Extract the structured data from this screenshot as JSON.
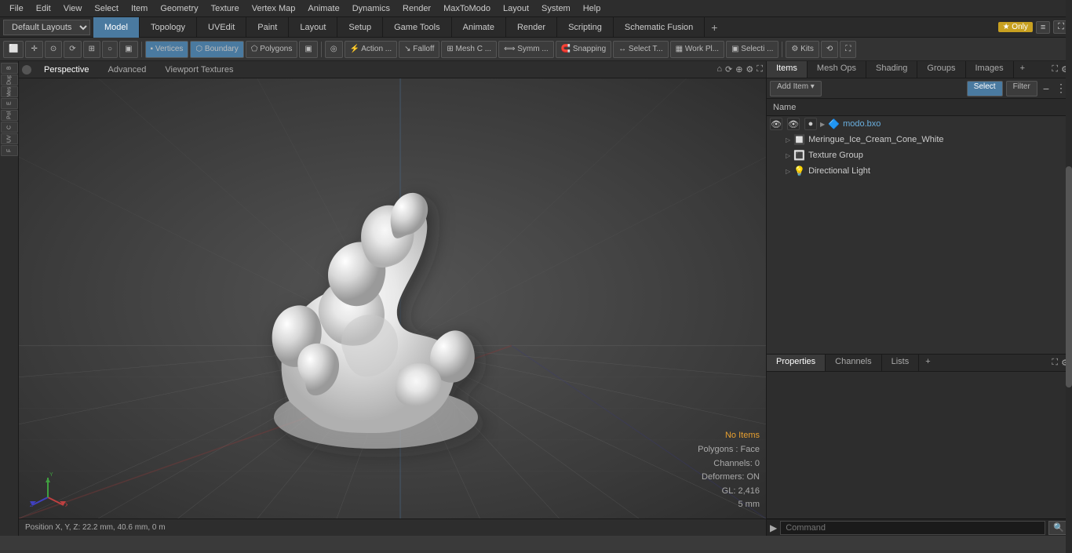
{
  "menubar": {
    "items": [
      "File",
      "Edit",
      "View",
      "Select",
      "Item",
      "Geometry",
      "Texture",
      "Vertex Map",
      "Animate",
      "Dynamics",
      "Render",
      "MaxToModo",
      "Layout",
      "System",
      "Help"
    ]
  },
  "layout": {
    "dropdown": "Default Layouts",
    "tabs": [
      "Model",
      "Topology",
      "UVEdit",
      "Paint",
      "Layout",
      "Setup",
      "Game Tools",
      "Animate",
      "Render",
      "Scripting",
      "Schematic Fusion"
    ],
    "active_tab": "Model",
    "plus_label": "+",
    "star_label": "★ Only"
  },
  "toolbar": {
    "buttons": [
      {
        "label": "⬛",
        "name": "select-mode-box"
      },
      {
        "label": "⊕",
        "name": "transform-btn"
      },
      {
        "label": "⟳",
        "name": "rotate-btn"
      },
      {
        "label": "Vertices",
        "name": "vertices-btn"
      },
      {
        "label": "Boundary",
        "name": "boundary-btn"
      },
      {
        "label": "Polygons",
        "name": "polygons-btn"
      },
      {
        "label": "▣",
        "name": "poly-type-btn"
      },
      {
        "label": "○",
        "name": "circle-btn"
      },
      {
        "label": "Action ...",
        "name": "action-btn"
      },
      {
        "label": "Falloff",
        "name": "falloff-btn"
      },
      {
        "label": "Mesh C ...",
        "name": "mesh-constraint-btn"
      },
      {
        "label": "Symm ...",
        "name": "symmetry-btn"
      },
      {
        "label": "Snapping",
        "name": "snapping-btn"
      },
      {
        "label": "Select T...",
        "name": "select-transform-btn"
      },
      {
        "label": "Work Pl...",
        "name": "work-plane-btn"
      },
      {
        "label": "Selecti ...",
        "name": "selection-btn"
      },
      {
        "label": "Kits",
        "name": "kits-btn"
      },
      {
        "label": "⟲",
        "name": "undo-view-btn"
      },
      {
        "label": "⛶",
        "name": "fullscreen-btn"
      }
    ]
  },
  "viewport": {
    "tabs": [
      "Perspective",
      "Advanced",
      "Viewport Textures"
    ],
    "active_tab": "Perspective"
  },
  "viewport_status": {
    "no_items": "No Items",
    "polygons": "Polygons : Face",
    "channels": "Channels: 0",
    "deformers": "Deformers: ON",
    "gl": "GL: 2,416",
    "size": "5 mm"
  },
  "status_bar": {
    "position": "Position X, Y, Z:  22.2 mm, 40.6 mm, 0 m"
  },
  "right_panel": {
    "tabs": [
      "Items",
      "Mesh Ops",
      "Shading",
      "Groups",
      "Images"
    ],
    "active_tab": "Items",
    "toolbar": {
      "add_item": "Add Item",
      "filter": "Filter",
      "select": "Select"
    },
    "name_column": "Name",
    "items": [
      {
        "id": "modo-bxo",
        "label": "modo.bxo",
        "icon": "mesh",
        "level": 0,
        "expanded": true,
        "eye": true
      },
      {
        "id": "meringue",
        "label": "Meringue_Ice_Cream_Cone_White",
        "icon": "mesh",
        "level": 1,
        "expanded": false,
        "eye": true
      },
      {
        "id": "texture-group",
        "label": "Texture Group",
        "icon": "texture",
        "level": 1,
        "expanded": false,
        "eye": true
      },
      {
        "id": "directional-light",
        "label": "Directional Light",
        "icon": "light",
        "level": 1,
        "expanded": false,
        "eye": true
      }
    ]
  },
  "properties_panel": {
    "tabs": [
      "Properties",
      "Channels",
      "Lists"
    ],
    "active_tab": "Properties",
    "plus_label": "+"
  },
  "command_bar": {
    "arrow": "▶",
    "placeholder": "Command",
    "search_label": "🔍"
  },
  "left_sidebar": {
    "items": [
      "B",
      "Dup",
      "Mes",
      "E",
      "Pol",
      "C",
      "UV",
      "F"
    ]
  }
}
